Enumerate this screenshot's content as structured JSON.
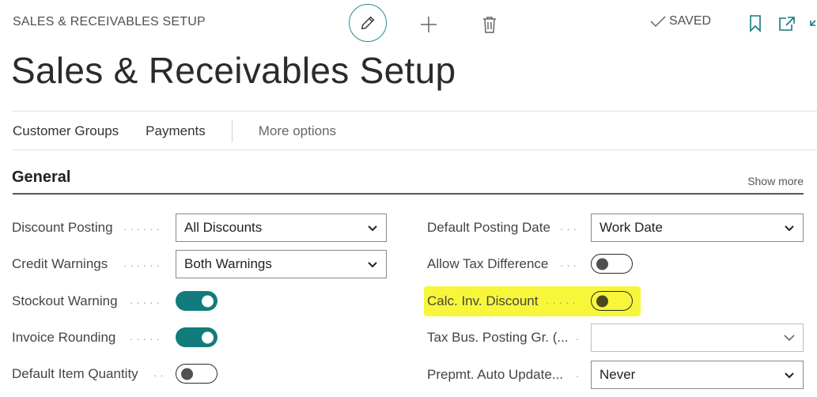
{
  "header": {
    "breadcrumb": "SALES & RECEIVABLES SETUP",
    "saved_label": "SAVED"
  },
  "page": {
    "title": "Sales & Receivables Setup"
  },
  "actions": {
    "customer_groups": "Customer Groups",
    "payments": "Payments",
    "more_options": "More options"
  },
  "section": {
    "title": "General",
    "show_more": "Show more"
  },
  "fields_left": [
    {
      "label": "Discount Posting",
      "type": "select",
      "value": "All Discounts"
    },
    {
      "label": "Credit Warnings",
      "type": "select",
      "value": "Both Warnings"
    },
    {
      "label": "Stockout Warning",
      "type": "toggle",
      "value": true
    },
    {
      "label": "Invoice Rounding",
      "type": "toggle",
      "value": true
    },
    {
      "label": "Default Item Quantity",
      "type": "toggle",
      "value": false
    }
  ],
  "fields_right": [
    {
      "label": "Default Posting Date",
      "type": "select",
      "value": "Work Date"
    },
    {
      "label": "Allow Tax Difference",
      "type": "toggle",
      "value": false
    },
    {
      "label": "Calc. Inv. Discount",
      "type": "toggle",
      "value": false,
      "highlighted": true
    },
    {
      "label": "Tax Bus. Posting Gr. (...",
      "type": "select",
      "value": ""
    },
    {
      "label": "Prepmt. Auto Update...",
      "type": "select",
      "value": "Never"
    }
  ],
  "icons": {
    "edit": "pencil-icon",
    "new": "plus-icon",
    "delete": "trash-icon",
    "saved": "checkmark-icon",
    "bookmark": "bookmark-icon",
    "open_new_window": "popout-icon",
    "collapse": "collapse-icon"
  },
  "colors": {
    "accent": "#127b7b",
    "highlight": "#f8f63a"
  }
}
